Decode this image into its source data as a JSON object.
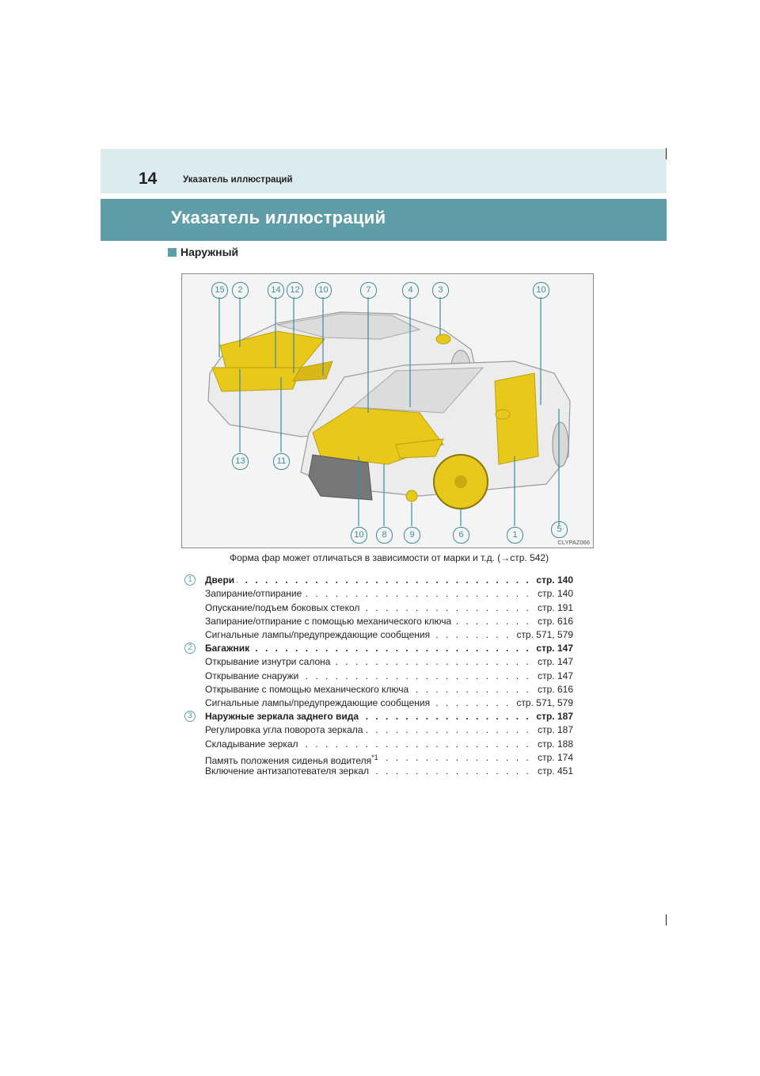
{
  "header": {
    "page_number": "14",
    "running_title": "Указатель иллюстраций"
  },
  "title": "Указатель иллюстраций",
  "subtitle": "Наружный",
  "figure": {
    "code": "CLYPAZ066",
    "callouts_top": [
      "15",
      "2",
      "14",
      "12",
      "10",
      "7",
      "4",
      "3",
      "10"
    ],
    "callouts_mid": [
      "13",
      "11"
    ],
    "callouts_bottom": [
      "10",
      "8",
      "9",
      "6",
      "1",
      "5"
    ],
    "colors": {
      "highlight": "#e8c81a",
      "callout": "#3e8c9c",
      "body": "#e8e8e8"
    }
  },
  "caption": "Форма фар может отличаться в зависимости от марки и т.д. (→стр. 542)",
  "sections": [
    {
      "number": "1",
      "title": "Двери",
      "page": "стр. 140",
      "items": [
        {
          "label": "Запирание/отпирание",
          "page": "стр. 140"
        },
        {
          "label": "Опускание/подъем боковых стекол",
          "page": "стр. 191"
        },
        {
          "label": "Запирание/отпирание с помощью механического ключа",
          "page": "стр. 616"
        },
        {
          "label": "Сигнальные лампы/предупреждающие сообщения",
          "page": "стр. 571, 579"
        }
      ]
    },
    {
      "number": "2",
      "title": "Багажник",
      "page": "стр. 147",
      "items": [
        {
          "label": "Открывание изнутри салона",
          "page": "стр. 147"
        },
        {
          "label": "Открывание снаружи",
          "page": "стр. 147"
        },
        {
          "label": "Открывание с помощью механического ключа",
          "page": "стр. 616"
        },
        {
          "label": "Сигнальные лампы/предупреждающие сообщения",
          "page": "стр. 571, 579"
        }
      ]
    },
    {
      "number": "3",
      "title": "Наружные зеркала заднего вида",
      "page": "стр. 187",
      "items": [
        {
          "label": "Регулировка угла поворота зеркала",
          "page": "стр. 187"
        },
        {
          "label": "Складывание зеркал",
          "page": "стр. 188"
        },
        {
          "label": "Память положения сиденья водителя",
          "sup": "*1",
          "page": "стр. 174"
        },
        {
          "label": "Включение антизапотевателя зеркал",
          "page": "стр. 451"
        }
      ]
    }
  ]
}
